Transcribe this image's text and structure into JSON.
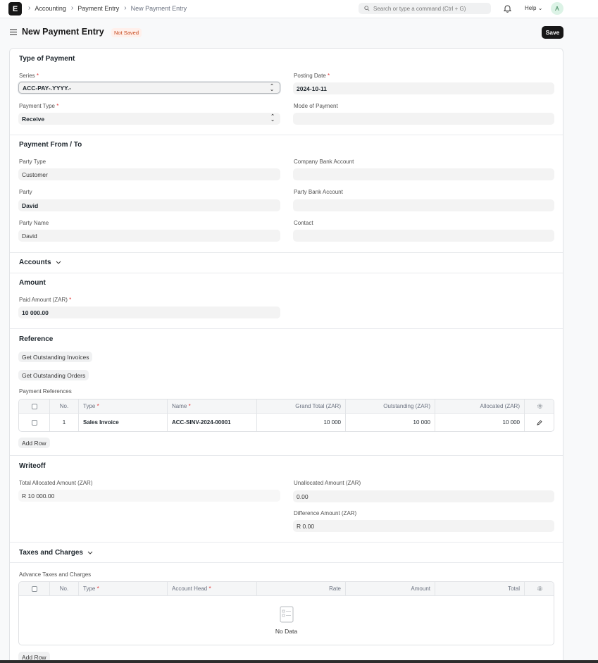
{
  "navbar": {
    "logo": "E",
    "breadcrumbs": [
      "Accounting",
      "Payment Entry",
      "New Payment Entry"
    ],
    "search_placeholder": "Search or type a command (Ctrl + G)",
    "help_label": "Help",
    "avatar_initial": "A"
  },
  "page": {
    "title": "New Payment Entry",
    "status": "Not Saved",
    "save_label": "Save"
  },
  "type_of_payment": {
    "title": "Type of Payment",
    "series_label": "Series",
    "series_value": "ACC-PAY-.YYYY.-",
    "posting_date_label": "Posting Date",
    "posting_date_value": "2024-10-11",
    "payment_type_label": "Payment Type",
    "payment_type_value": "Receive",
    "mode_of_payment_label": "Mode of Payment",
    "mode_of_payment_value": ""
  },
  "payment_from_to": {
    "title": "Payment From / To",
    "party_type_label": "Party Type",
    "party_type_value": "Customer",
    "company_bank_account_label": "Company Bank Account",
    "company_bank_account_value": "",
    "party_label": "Party",
    "party_value": "David",
    "party_bank_account_label": "Party Bank Account",
    "party_bank_account_value": "",
    "party_name_label": "Party Name",
    "party_name_value": "David",
    "contact_label": "Contact",
    "contact_value": ""
  },
  "accounts": {
    "title": "Accounts"
  },
  "amount": {
    "title": "Amount",
    "paid_amount_label": "Paid Amount (ZAR)",
    "paid_amount_value": "10 000.00"
  },
  "reference": {
    "title": "Reference",
    "get_invoices_label": "Get Outstanding Invoices",
    "get_orders_label": "Get Outstanding Orders",
    "table_label": "Payment References",
    "columns": {
      "no": "No.",
      "type": "Type",
      "name": "Name",
      "grand_total": "Grand Total (ZAR)",
      "outstanding": "Outstanding (ZAR)",
      "allocated": "Allocated (ZAR)"
    },
    "rows": [
      {
        "no": "1",
        "type": "Sales Invoice",
        "name": "ACC-SINV-2024-00001",
        "grand_total": "10 000",
        "outstanding": "10 000",
        "allocated": "10 000"
      }
    ],
    "add_row_label": "Add Row"
  },
  "writeoff": {
    "title": "Writeoff",
    "total_allocated_label": "Total Allocated Amount (ZAR)",
    "total_allocated_value": "R 10 000.00",
    "unallocated_label": "Unallocated Amount (ZAR)",
    "unallocated_value": "0.00",
    "difference_label": "Difference Amount (ZAR)",
    "difference_value": "R 0.00"
  },
  "taxes": {
    "title": "Taxes and Charges",
    "table_label": "Advance Taxes and Charges",
    "columns": {
      "no": "No.",
      "type": "Type",
      "account_head": "Account Head",
      "rate": "Rate",
      "amount": "Amount",
      "total": "Total"
    },
    "no_data": "No Data",
    "add_row_label": "Add Row"
  },
  "colors": {
    "primary_button": "#171717",
    "badge_bg": "#fff0eb",
    "badge_text": "#c74a1f",
    "required_mark": "#e03636"
  }
}
